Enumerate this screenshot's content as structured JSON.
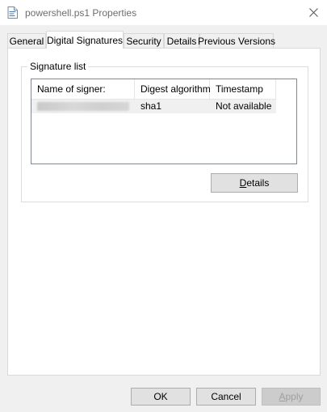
{
  "window": {
    "title": "powershell.ps1 Properties",
    "close_label": "✕"
  },
  "tabs": [
    {
      "label": "General",
      "active": false
    },
    {
      "label": "Digital Signatures",
      "active": true
    },
    {
      "label": "Security",
      "active": false
    },
    {
      "label": "Details",
      "active": false
    },
    {
      "label": "Previous Versions",
      "active": false
    }
  ],
  "signature_group": {
    "legend": "Signature list",
    "columns": [
      "Name of signer:",
      "Digest algorithm",
      "Timestamp"
    ],
    "rows": [
      {
        "signer": "",
        "digest": "sha1",
        "timestamp": "Not available"
      }
    ],
    "details_button": {
      "mnemonic": "D",
      "rest": "etails"
    }
  },
  "footer": {
    "ok": "OK",
    "cancel": "Cancel",
    "apply_mnemonic": "A",
    "apply_rest": "pply"
  },
  "icons": {
    "title": "script-file-icon",
    "close": "close-icon"
  }
}
